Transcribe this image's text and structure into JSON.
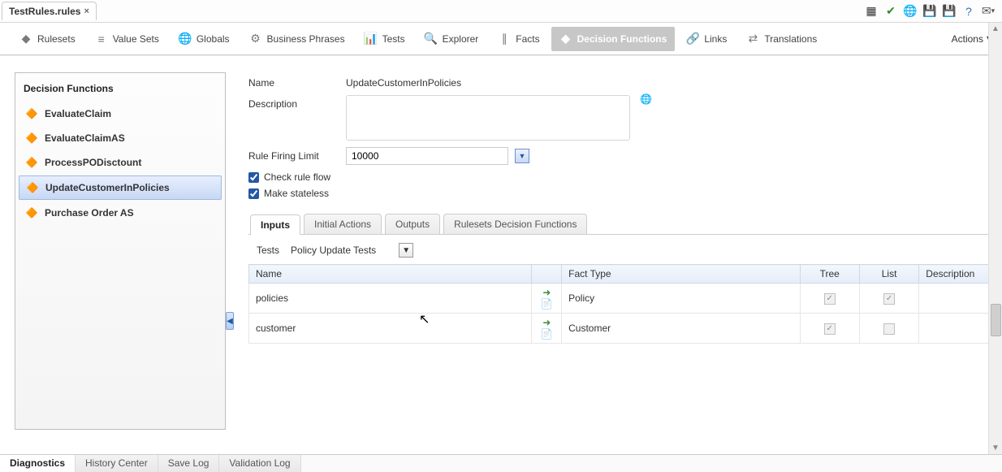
{
  "file_tab": {
    "name": "TestRules.rules"
  },
  "toolbar_icons": [
    "validate-icon",
    "check-icon",
    "globe-icon",
    "save-icon",
    "save-all-icon",
    "help-icon",
    "mail-icon"
  ],
  "main_tabs": [
    {
      "label": "Rulesets",
      "glyph": "◆"
    },
    {
      "label": "Value Sets",
      "glyph": "≡"
    },
    {
      "label": "Globals",
      "glyph": "🌐"
    },
    {
      "label": "Business Phrases",
      "glyph": "⚙"
    },
    {
      "label": "Tests",
      "glyph": "📊"
    },
    {
      "label": "Explorer",
      "glyph": "🔍"
    },
    {
      "label": "Facts",
      "glyph": "∥"
    },
    {
      "label": "Decision Functions",
      "glyph": "◆",
      "active": true
    },
    {
      "label": "Links",
      "glyph": "🔗"
    },
    {
      "label": "Translations",
      "glyph": "⇄"
    }
  ],
  "actions_label": "Actions",
  "sidebar": {
    "title": "Decision Functions",
    "items": [
      {
        "label": "EvaluateClaim"
      },
      {
        "label": "EvaluateClaimAS"
      },
      {
        "label": "ProcessPODisctount"
      },
      {
        "label": "UpdateCustomerInPolicies",
        "selected": true
      },
      {
        "label": "Purchase Order AS"
      }
    ]
  },
  "form": {
    "name_label": "Name",
    "name_value": "UpdateCustomerInPolicies",
    "desc_label": "Description",
    "desc_value": "",
    "rfl_label": "Rule Firing Limit",
    "rfl_value": "10000",
    "check_rule_flow": {
      "label": "Check rule flow",
      "checked": true
    },
    "make_stateless": {
      "label": "Make stateless",
      "checked": true
    }
  },
  "sub_tabs": [
    {
      "label": "Inputs",
      "active": true
    },
    {
      "label": "Initial Actions"
    },
    {
      "label": "Outputs"
    },
    {
      "label": "Rulesets Decision Functions"
    }
  ],
  "tests_row": {
    "label": "Tests",
    "value": "Policy Update Tests"
  },
  "inputs_table": {
    "headers": {
      "name": "Name",
      "fact_type": "Fact Type",
      "tree": "Tree",
      "list": "List",
      "desc": "Description"
    },
    "rows": [
      {
        "name": "policies",
        "fact_type": "Policy",
        "tree": true,
        "list": true
      },
      {
        "name": "customer",
        "fact_type": "Customer",
        "tree": true,
        "list": false
      }
    ]
  },
  "status_tabs": [
    {
      "label": "Diagnostics",
      "active": true
    },
    {
      "label": "History Center"
    },
    {
      "label": "Save Log"
    },
    {
      "label": "Validation Log"
    }
  ]
}
